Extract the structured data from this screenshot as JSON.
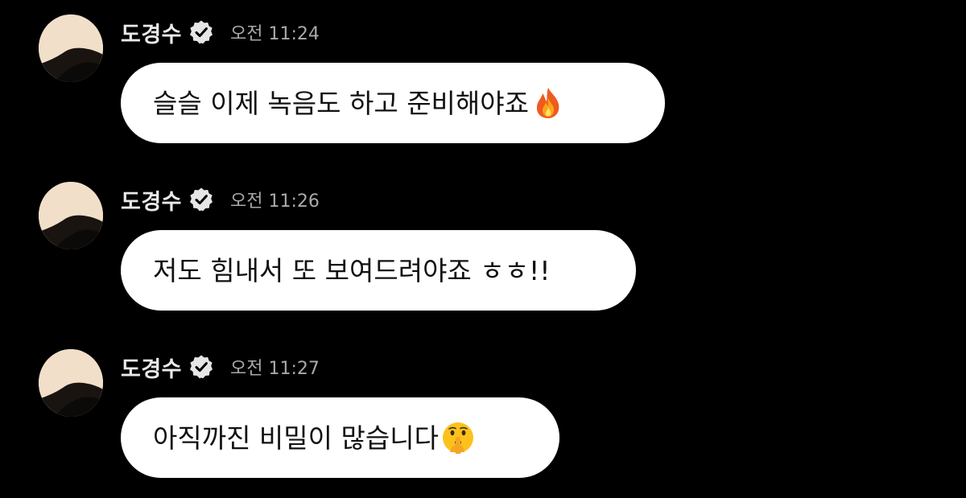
{
  "messages": [
    {
      "sender": "도경수",
      "time": "오전 11:24",
      "text": "슬슬 이제 녹음도 하고 준비해야죠",
      "emoji": "fire-emoji"
    },
    {
      "sender": "도경수",
      "time": "오전 11:26",
      "text": "저도 힘내서 또 보여드려야죠 ㅎㅎ!!",
      "emoji": ""
    },
    {
      "sender": "도경수",
      "time": "오전 11:27",
      "text": "아직까진 비밀이 많습니다",
      "emoji": "shushing-face-emoji"
    }
  ],
  "icons": {
    "verified": "verified-badge-icon",
    "avatar": "profile-avatar"
  },
  "colors": {
    "background": "#000000",
    "bubble": "#ffffff",
    "name": "#e9e9e9",
    "time": "#a9a9a9"
  }
}
